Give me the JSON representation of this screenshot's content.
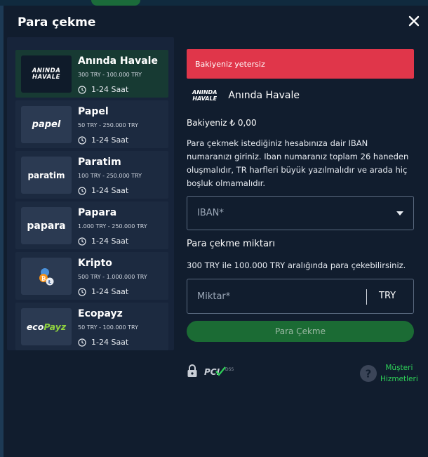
{
  "modal": {
    "title": "Para çekme"
  },
  "methods": [
    {
      "name": "Anında Havale",
      "range": "300 TRY - 100.000 TRY",
      "time": "1-24 Saat",
      "logo": "ANINDA HAVALE",
      "active": true
    },
    {
      "name": "Papel",
      "range": "50 TRY - 250.000 TRY",
      "time": "1-24 Saat",
      "logo": "papel",
      "active": false
    },
    {
      "name": "Paratim",
      "range": "100 TRY - 250.000 TRY",
      "time": "1-24 Saat",
      "logo": "paratim",
      "active": false
    },
    {
      "name": "Papara",
      "range": "1.000 TRY - 250.000 TRY",
      "time": "1-24 Saat",
      "logo": "papara",
      "active": false
    },
    {
      "name": "Kripto",
      "range": "500 TRY - 1.000.000 TRY",
      "time": "1-24 Saat",
      "logo": "crypto-coins-icon",
      "active": false
    },
    {
      "name": "Ecopayz",
      "range": "50 TRY - 100.000 TRY",
      "time": "1-24 Saat",
      "logo": "ecoPayz",
      "active": false
    }
  ],
  "form": {
    "alert": "Bakiyeniz yetersiz",
    "selected_method": "Anında Havale",
    "selected_logo_line1": "ANINDA",
    "selected_logo_line2": "HAVALE",
    "balance": "Bakiyeniz ₺ 0,00",
    "info": "Para çekmek istediğiniz hesabınıza dair IBAN numaranızı giriniz. Iban numaranız toplam 26 haneden oluşmalıdır, TR harfleri büyük yazılmalıdır ve arada hiç boşluk olmamalıdır.",
    "iban_placeholder": "IBAN*",
    "amount_title": "Para çekme miktarı",
    "amount_range": "300 TRY ile 100.000 TRY aralığında para çekebilirsiniz.",
    "amount_placeholder": "Miktar*",
    "currency": "TRY",
    "submit": "Para Çekme",
    "pci_label": "PCI DSS",
    "support_line1": "Müşteri",
    "support_line2": "Hizmetleri"
  },
  "colors": {
    "accent_green": "#2ed158",
    "alert_red": "#e0364a",
    "panel": "#111d2e"
  }
}
